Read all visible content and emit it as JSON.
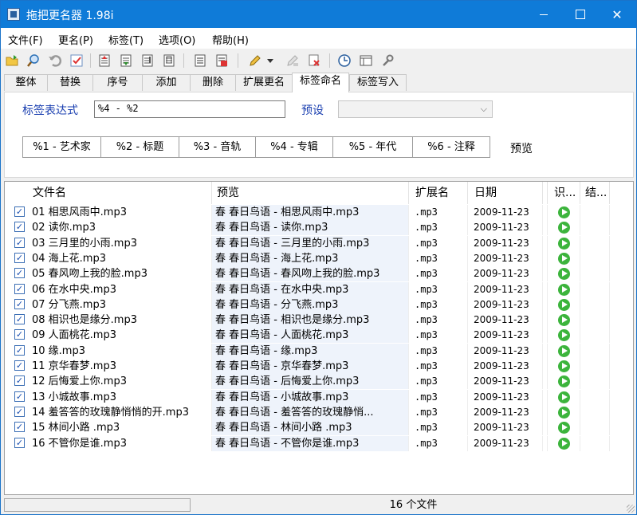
{
  "window": {
    "title": "拖把更名器 1.98i"
  },
  "menu": [
    "文件(F)",
    "更名(P)",
    "标签(T)",
    "选项(O)",
    "帮助(H)"
  ],
  "toolbar_icons": [
    "add-files-icon",
    "search-icon",
    "undo-icon",
    "check-icon",
    "move-up-icon",
    "move-down-icon",
    "move-top-icon",
    "move-bottom-icon",
    "list-icon",
    "clear-list-icon",
    "brush-icon",
    "dropdown-icon",
    "filter-icon",
    "remove-icon",
    "clock-icon",
    "window-icon",
    "settings-icon"
  ],
  "tabs": [
    "整体",
    "替换",
    "序号",
    "添加",
    "删除",
    "扩展更名",
    "标签命名",
    "标签写入"
  ],
  "active_tab": "标签命名",
  "panel": {
    "expr_label": "标签表达式",
    "expr_value": "%4 - %2",
    "preset_label": "预设",
    "preset_value": "",
    "tag_buttons": [
      "%1 - 艺术家",
      "%2 - 标题",
      "%3 - 音轨",
      "%4 - 专辑",
      "%5 - 年代",
      "%6 - 注释"
    ],
    "preview_label": "预览"
  },
  "columns": [
    "文件名",
    "预览",
    "扩展名",
    "日期",
    "识...",
    "结..."
  ],
  "rows": [
    {
      "name": "01 相思风雨中.mp3",
      "preview": "春 春日鸟语 - 相思风雨中.mp3",
      "ext": ".mp3",
      "date": "2009-11-23"
    },
    {
      "name": "02 读你.mp3",
      "preview": "春 春日鸟语 - 读你.mp3",
      "ext": ".mp3",
      "date": "2009-11-23"
    },
    {
      "name": "03 三月里的小雨.mp3",
      "preview": "春 春日鸟语 - 三月里的小雨.mp3",
      "ext": ".mp3",
      "date": "2009-11-23"
    },
    {
      "name": "04 海上花.mp3",
      "preview": "春 春日鸟语 - 海上花.mp3",
      "ext": ".mp3",
      "date": "2009-11-23"
    },
    {
      "name": "05 春风吻上我的脸.mp3",
      "preview": "春 春日鸟语 - 春风吻上我的脸.mp3",
      "ext": ".mp3",
      "date": "2009-11-23"
    },
    {
      "name": "06 在水中央.mp3",
      "preview": "春 春日鸟语 - 在水中央.mp3",
      "ext": ".mp3",
      "date": "2009-11-23"
    },
    {
      "name": "07 分飞燕.mp3",
      "preview": "春 春日鸟语 - 分飞燕.mp3",
      "ext": ".mp3",
      "date": "2009-11-23"
    },
    {
      "name": "08 相识也是缘分.mp3",
      "preview": "春 春日鸟语 - 相识也是缘分.mp3",
      "ext": ".mp3",
      "date": "2009-11-23"
    },
    {
      "name": "09 人面桃花.mp3",
      "preview": "春 春日鸟语 - 人面桃花.mp3",
      "ext": ".mp3",
      "date": "2009-11-23"
    },
    {
      "name": "10 缘.mp3",
      "preview": "春 春日鸟语 - 缘.mp3",
      "ext": ".mp3",
      "date": "2009-11-23"
    },
    {
      "name": "11 京华春梦.mp3",
      "preview": "春 春日鸟语 - 京华春梦.mp3",
      "ext": ".mp3",
      "date": "2009-11-23"
    },
    {
      "name": "12 后悔爱上你.mp3",
      "preview": "春 春日鸟语 - 后悔爱上你.mp3",
      "ext": ".mp3",
      "date": "2009-11-23"
    },
    {
      "name": "13 小城故事.mp3",
      "preview": "春 春日鸟语 - 小城故事.mp3",
      "ext": ".mp3",
      "date": "2009-11-23"
    },
    {
      "name": "14 羞答答的玫瑰静悄悄的开.mp3",
      "preview": "春 春日鸟语 - 羞答答的玫瑰静悄...",
      "ext": ".mp3",
      "date": "2009-11-23"
    },
    {
      "name": "15 林间小路 .mp3",
      "preview": "春 春日鸟语 - 林间小路 .mp3",
      "ext": ".mp3",
      "date": "2009-11-23"
    },
    {
      "name": "16 不管你是谁.mp3",
      "preview": "春 春日鸟语 - 不管你是谁.mp3",
      "ext": ".mp3",
      "date": "2009-11-23"
    }
  ],
  "status": {
    "count_text": "16 个文件"
  },
  "colors": {
    "titlebar": "#0f7bd8",
    "label_blue": "#1a3fb0",
    "status_ok": "#3cb43c"
  }
}
